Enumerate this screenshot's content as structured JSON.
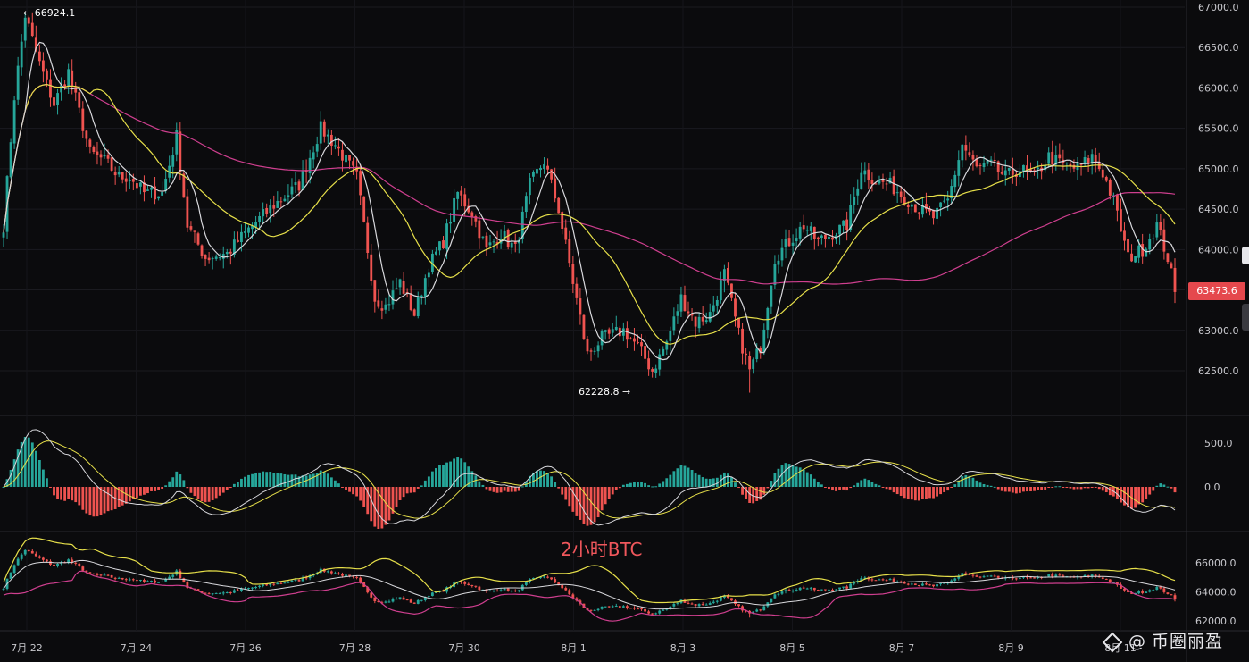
{
  "chart_data": [
    {
      "type": "candlestick",
      "panel": "price",
      "y_ticks": [
        "67000.0",
        "66500.0",
        "66000.0",
        "65500.0",
        "65000.0",
        "64500.0",
        "64000.0",
        "63500.0",
        "63000.0",
        "62500.0"
      ],
      "ylim": [
        62000,
        67000
      ],
      "x_ticks": [
        "7月 22",
        "7月 24",
        "7月 26",
        "7月 28",
        "7月 30",
        "8月 1",
        "8月 3",
        "8月 5",
        "8月 7",
        "8月 9",
        "8月 11"
      ],
      "high_annotation": "← 66924.1",
      "low_annotation": "62228.8 →",
      "last_price": "63473.6",
      "anchors": [
        [
          0,
          64300
        ],
        [
          3,
          65900
        ],
        [
          6,
          66900
        ],
        [
          10,
          66300
        ],
        [
          14,
          65800
        ],
        [
          18,
          66200
        ],
        [
          24,
          65200
        ],
        [
          28,
          65100
        ],
        [
          32,
          64900
        ],
        [
          35,
          64900
        ],
        [
          39,
          64700
        ],
        [
          44,
          64700
        ],
        [
          48,
          65400
        ],
        [
          51,
          64300
        ],
        [
          56,
          63900
        ],
        [
          62,
          63950
        ],
        [
          68,
          64250
        ],
        [
          75,
          64550
        ],
        [
          82,
          64800
        ],
        [
          88,
          65500
        ],
        [
          92,
          65300
        ],
        [
          98,
          64900
        ],
        [
          103,
          63400
        ],
        [
          106,
          63300
        ],
        [
          110,
          63600
        ],
        [
          114,
          63200
        ],
        [
          118,
          63800
        ],
        [
          122,
          64100
        ],
        [
          126,
          64700
        ],
        [
          130,
          64450
        ],
        [
          134,
          64000
        ],
        [
          138,
          64200
        ],
        [
          142,
          64000
        ],
        [
          146,
          64800
        ],
        [
          150,
          65100
        ],
        [
          154,
          64500
        ],
        [
          158,
          63600
        ],
        [
          162,
          62700
        ],
        [
          166,
          62900
        ],
        [
          172,
          63000
        ],
        [
          176,
          62800
        ],
        [
          180,
          62500
        ],
        [
          184,
          62850
        ],
        [
          188,
          63400
        ],
        [
          192,
          63100
        ],
        [
          196,
          63200
        ],
        [
          200,
          63700
        ],
        [
          204,
          62950
        ],
        [
          207,
          62500
        ],
        [
          210,
          62800
        ],
        [
          214,
          63900
        ],
        [
          218,
          64100
        ],
        [
          222,
          64300
        ],
        [
          226,
          64100
        ],
        [
          230,
          64200
        ],
        [
          234,
          64300
        ],
        [
          238,
          65000
        ],
        [
          242,
          64850
        ],
        [
          246,
          64800
        ],
        [
          250,
          64650
        ],
        [
          254,
          64500
        ],
        [
          258,
          64400
        ],
        [
          262,
          64600
        ],
        [
          266,
          65300
        ],
        [
          270,
          65000
        ],
        [
          274,
          65050
        ],
        [
          278,
          64900
        ],
        [
          282,
          65000
        ],
        [
          286,
          64900
        ],
        [
          290,
          65150
        ],
        [
          294,
          65050
        ],
        [
          298,
          65000
        ],
        [
          302,
          65150
        ],
        [
          305,
          64950
        ],
        [
          308,
          64600
        ],
        [
          312,
          63900
        ],
        [
          316,
          64000
        ],
        [
          320,
          64300
        ],
        [
          323,
          63900
        ],
        [
          325,
          63473.6
        ]
      ]
    },
    {
      "type": "macd",
      "panel": "indicator",
      "y_ticks": [
        "500.0",
        "0.0"
      ],
      "ylim": [
        -400,
        620
      ]
    },
    {
      "type": "line",
      "panel": "bollinger",
      "y_ticks": [
        "66000.0",
        "64000.0",
        "62000.0"
      ],
      "ylim": [
        61800,
        67600
      ]
    }
  ],
  "labels": {
    "chart_title": "2小时BTC",
    "watermark_brand": "币圈丽盈",
    "watermark_at": "@"
  },
  "colors": {
    "up": "#26a69a",
    "down": "#ef5350",
    "background": "#0b0b0d",
    "ma_white": "#d8d8dc",
    "ma_yellow": "#e7e04a",
    "ma_magenta": "#cf3f8f",
    "badge": "#e5484d"
  }
}
